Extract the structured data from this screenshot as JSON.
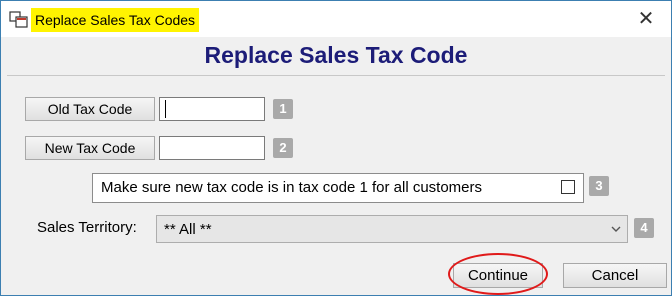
{
  "window": {
    "title": "Replace Sales Tax Codes",
    "close_glyph": "✕"
  },
  "heading": "Replace Sales Tax Code",
  "old_tax_code": {
    "button_label": "Old Tax Code",
    "value": "",
    "step": "1"
  },
  "new_tax_code": {
    "button_label": "New Tax Code",
    "value": "",
    "step": "2"
  },
  "notice": {
    "text": "Make sure new tax code is in tax code 1 for all customers",
    "checked": false,
    "step": "3"
  },
  "sales_territory": {
    "label": "Sales Territory:",
    "selected": "** All **",
    "step": "4"
  },
  "actions": {
    "continue_label": "Continue",
    "cancel_label": "Cancel"
  },
  "colors": {
    "title_highlight": "#fff400",
    "heading": "#1c1c78",
    "annotation_circle": "#e01a1a",
    "step_badge": "#a9a9a9"
  }
}
